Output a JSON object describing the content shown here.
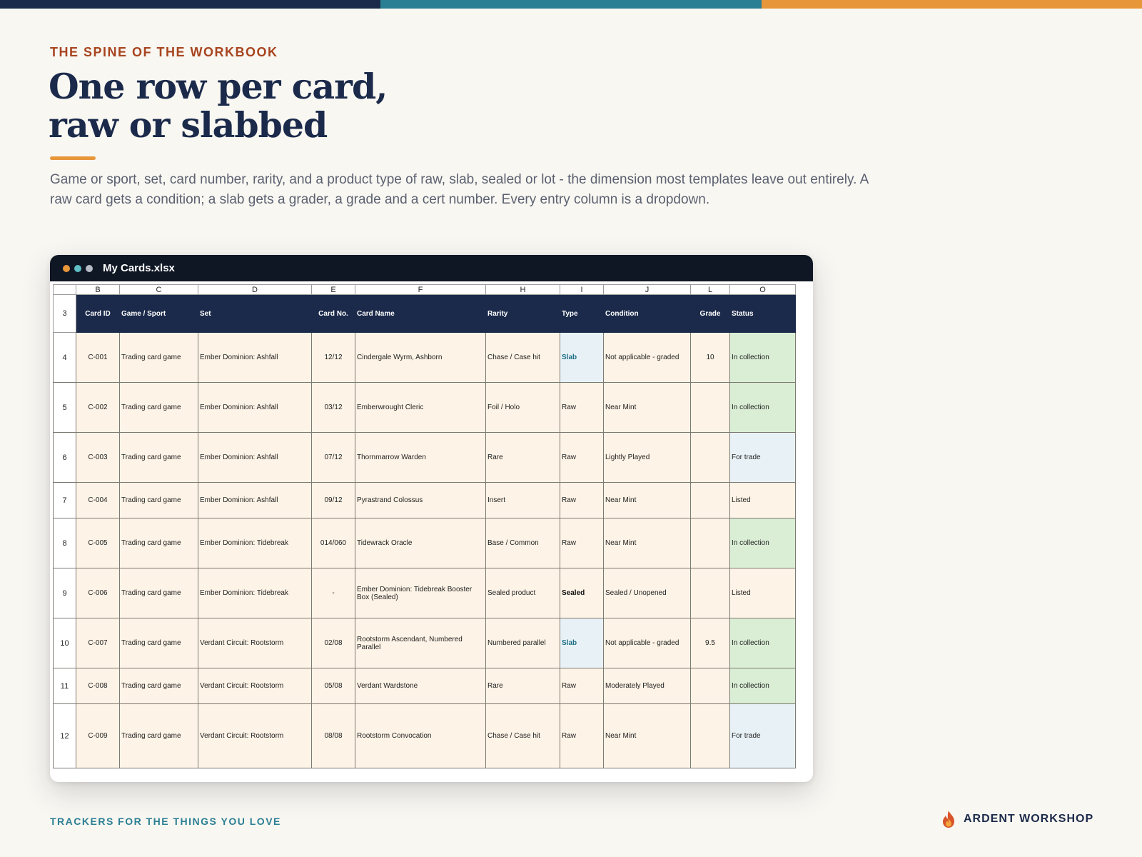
{
  "colors": {
    "navy": "#1b2a4a",
    "teal": "#2b7f93",
    "orange": "#e8963a",
    "rust": "#a7451f",
    "dot_orange": "#e8963a",
    "dot_teal": "#5fbfc4",
    "dot_gray": "#b5bac4"
  },
  "page": {
    "eyebrow": "THE SPINE OF THE WORKBOOK",
    "headline_line1": "One row per card,",
    "headline_line2": "raw or slabbed",
    "lede": "Game or sport, set, card number, rarity, and a product type of raw, slab, sealed or lot - the dimension most templates leave out entirely. A raw card gets a condition; a slab gets a grader, a grade and a cert number. Every entry column is a dropdown.",
    "footer_tagline": "TRACKERS FOR THE THINGS YOU LOVE",
    "brand_name": "ARDENT WORKSHOP",
    "brand_icon": "flame-icon"
  },
  "window": {
    "title": "My Cards.xlsx"
  },
  "sheet": {
    "column_letters": [
      "B",
      "C",
      "D",
      "E",
      "F",
      "H",
      "I",
      "J",
      "L",
      "O"
    ],
    "header_row_number": "3",
    "headers": [
      "Card ID",
      "Game / Sport",
      "Set",
      "Card No.",
      "Card Name",
      "Rarity",
      "Type",
      "Condition",
      "Grade",
      "Status"
    ],
    "rows": [
      {
        "num": "4",
        "id": "C-001",
        "game": "Trading card game",
        "set": "Ember Dominion: Ashfall",
        "no": "12/12",
        "name": "Cindergale Wyrm, Ashborn",
        "rarity": "Chase / Case hit",
        "type": "Slab",
        "condition": "Not applicable - graded",
        "grade": "10",
        "status": "In collection"
      },
      {
        "num": "5",
        "id": "C-002",
        "game": "Trading card game",
        "set": "Ember Dominion: Ashfall",
        "no": "03/12",
        "name": "Emberwrought Cleric",
        "rarity": "Foil / Holo",
        "type": "Raw",
        "condition": "Near Mint",
        "grade": "",
        "status": "In collection"
      },
      {
        "num": "6",
        "id": "C-003",
        "game": "Trading card game",
        "set": "Ember Dominion: Ashfall",
        "no": "07/12",
        "name": "Thornmarrow Warden",
        "rarity": "Rare",
        "type": "Raw",
        "condition": "Lightly Played",
        "grade": "",
        "status": "For trade"
      },
      {
        "num": "7",
        "id": "C-004",
        "game": "Trading card game",
        "set": "Ember Dominion: Ashfall",
        "no": "09/12",
        "name": "Pyrastrand Colossus",
        "rarity": "Insert",
        "type": "Raw",
        "condition": "Near Mint",
        "grade": "",
        "status": "Listed"
      },
      {
        "num": "8",
        "id": "C-005",
        "game": "Trading card game",
        "set": "Ember Dominion: Tidebreak",
        "no": "014/060",
        "name": "Tidewrack Oracle",
        "rarity": "Base / Common",
        "type": "Raw",
        "condition": "Near Mint",
        "grade": "",
        "status": "In collection"
      },
      {
        "num": "9",
        "id": "C-006",
        "game": "Trading card game",
        "set": "Ember Dominion: Tidebreak",
        "no": "-",
        "name": "Ember Dominion: Tidebreak Booster Box (Sealed)",
        "rarity": "Sealed product",
        "type": "Sealed",
        "condition": "Sealed / Unopened",
        "grade": "",
        "status": "Listed"
      },
      {
        "num": "10",
        "id": "C-007",
        "game": "Trading card game",
        "set": "Verdant Circuit: Rootstorm",
        "no": "02/08",
        "name": "Rootstorm Ascendant, Numbered Parallel",
        "rarity": "Numbered parallel",
        "type": "Slab",
        "condition": "Not applicable - graded",
        "grade": "9.5",
        "status": "In collection"
      },
      {
        "num": "11",
        "id": "C-008",
        "game": "Trading card game",
        "set": "Verdant Circuit: Rootstorm",
        "no": "05/08",
        "name": "Verdant Wardstone",
        "rarity": "Rare",
        "type": "Raw",
        "condition": "Moderately Played",
        "grade": "",
        "status": "In collection"
      },
      {
        "num": "12",
        "id": "C-009",
        "game": "Trading card game",
        "set": "Verdant Circuit: Rootstorm",
        "no": "08/08",
        "name": "Rootstorm Convocation",
        "rarity": "Chase / Case hit",
        "type": "Raw",
        "condition": "Near Mint",
        "grade": "",
        "status": "For trade"
      }
    ]
  }
}
